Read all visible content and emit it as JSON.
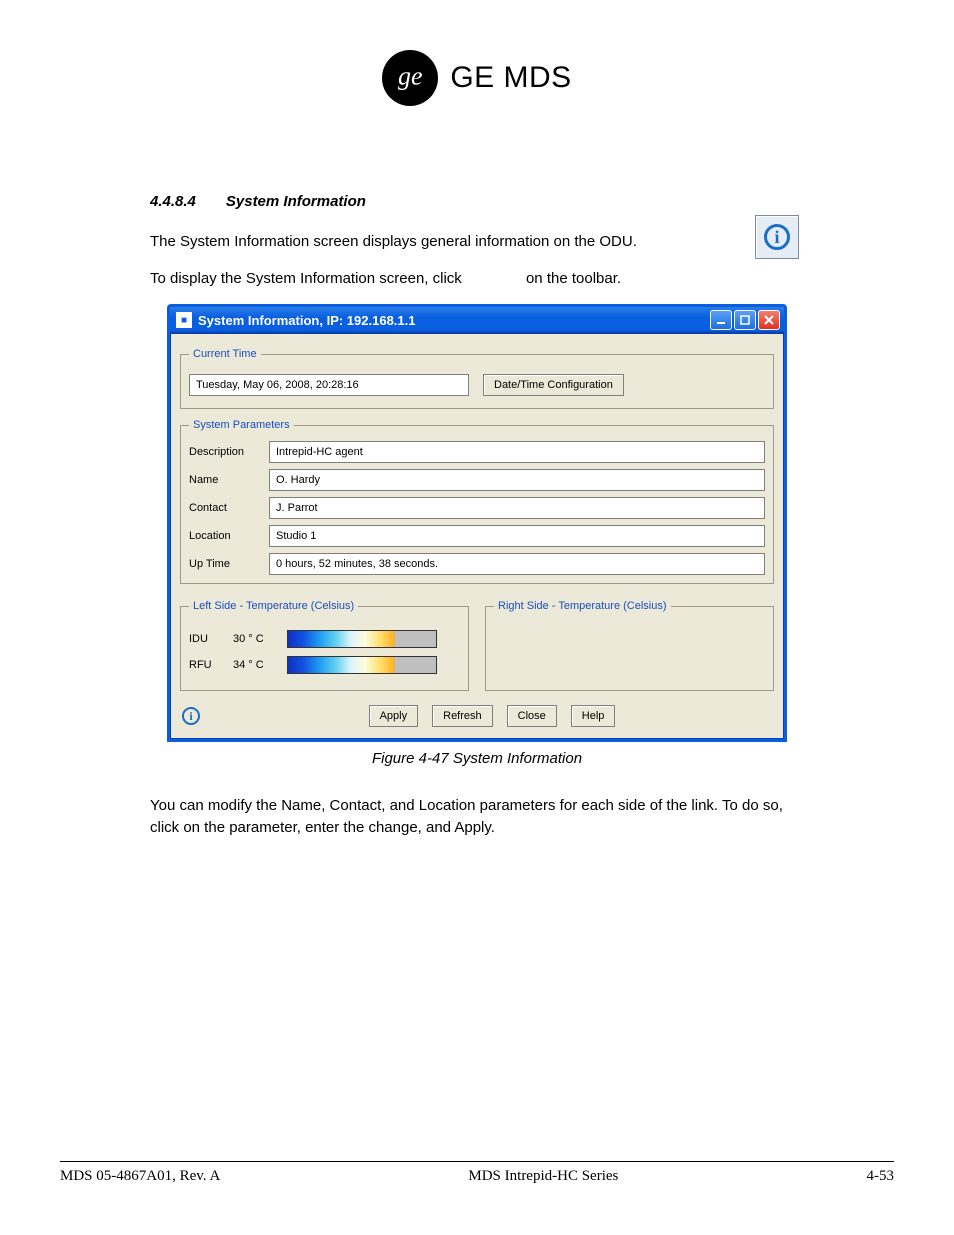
{
  "brand": {
    "text": "GE MDS"
  },
  "section": {
    "number": "4.4.8.4",
    "title": "System Information"
  },
  "paragraphs": {
    "intro": "The System Information screen displays general information on the ODU.",
    "howto_prefix": "To display the System Information screen, click",
    "howto_suffix": "on the toolbar.",
    "note": "You can modify the Name, Contact, and Location parameters for each side of the link. To do so, click on the parameter, enter the change, and Apply."
  },
  "figure": {
    "label": "Figure 4-47 System Information"
  },
  "window": {
    "title": "System Information, IP: 192.168.1.1"
  },
  "groups": {
    "current_time": "Current Time",
    "system_parameters": "System Parameters",
    "left_temp": "Left Side - Temperature (Celsius)",
    "right_temp": "Right Side - Temperature (Celsius)"
  },
  "current_time": {
    "value": "Tuesday, May 06, 2008, 20:28:16",
    "config_button": "Date/Time Configuration"
  },
  "params": {
    "labels": {
      "description": "Description",
      "name": "Name",
      "contact": "Contact",
      "location": "Location",
      "uptime": "Up Time"
    },
    "values": {
      "description": "Intrepid-HC agent",
      "name": "O. Hardy",
      "contact": "J.  Parrot",
      "location": "Studio 1",
      "uptime": "0 hours, 52  minutes, 38 seconds."
    }
  },
  "temps": {
    "idu": {
      "label": "IDU",
      "value": "30 ° C"
    },
    "rfu": {
      "label": "RFU",
      "value": "34 ° C"
    }
  },
  "buttons": {
    "apply": "Apply",
    "refresh": "Refresh",
    "close": "Close",
    "help": "Help"
  },
  "footer": {
    "left": "MDS 05-4867A01, Rev. A",
    "center": "MDS Intrepid-HC Series",
    "right": "4-53"
  }
}
